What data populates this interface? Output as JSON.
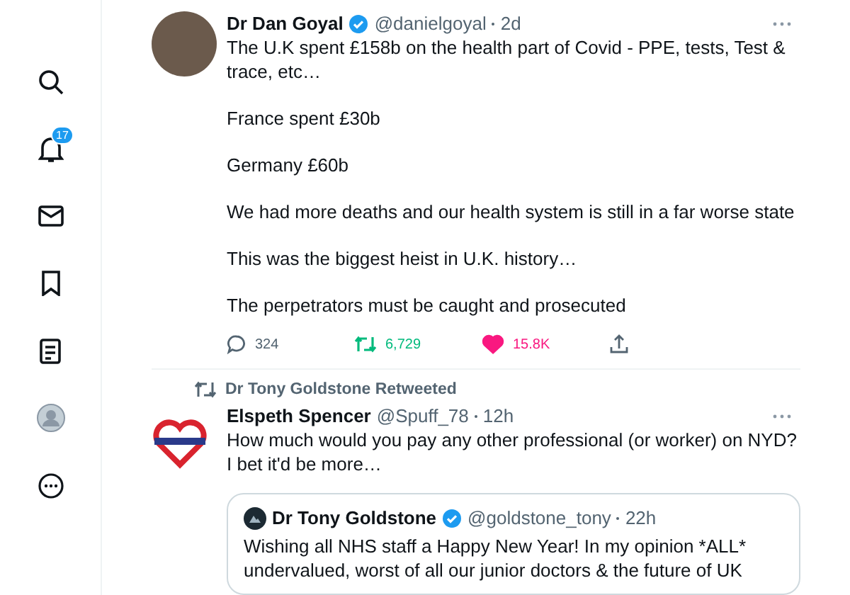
{
  "sidebar": {
    "items": [
      {
        "kind": "search"
      },
      {
        "kind": "notifications",
        "badge": "17"
      },
      {
        "kind": "messages"
      },
      {
        "kind": "bookmarks"
      },
      {
        "kind": "lists"
      },
      {
        "kind": "profile"
      },
      {
        "kind": "more"
      }
    ]
  },
  "tweets": [
    {
      "kind": "photo",
      "name": "Dr Dan Goyal",
      "verified": true,
      "handle": "@danielgoyal",
      "time": "2d",
      "paragraphs": [
        "The U.K spent £158b on the health part of Covid - PPE, tests, Test & trace, etc…",
        "France spent £30b",
        "Germany £60b",
        "We had more deaths and our health system is still in a far worse state",
        "This was the biggest heist in U.K. history…",
        "The perpetrators must be caught and prosecuted"
      ],
      "actions": {
        "replies": "324",
        "retweets": "6,729",
        "retweeted": true,
        "likes": "15.8K",
        "liked": true
      }
    },
    {
      "kind": "heart",
      "retweeted_by": "Dr Tony Goldstone Retweeted",
      "name": "Elspeth Spencer",
      "verified": false,
      "handle": "@Spuff_78",
      "time": "12h",
      "paragraphs": [
        "How much would you pay any other professional (or worker) on NYD? I bet it'd be more…"
      ],
      "quote": {
        "name": "Dr Tony Goldstone",
        "verified": true,
        "handle": "@goldstone_tony",
        "time": "22h",
        "text": "Wishing all NHS staff a Happy New Year! In my opinion *ALL* undervalued, worst of all our junior doctors & the future of UK"
      }
    }
  ]
}
